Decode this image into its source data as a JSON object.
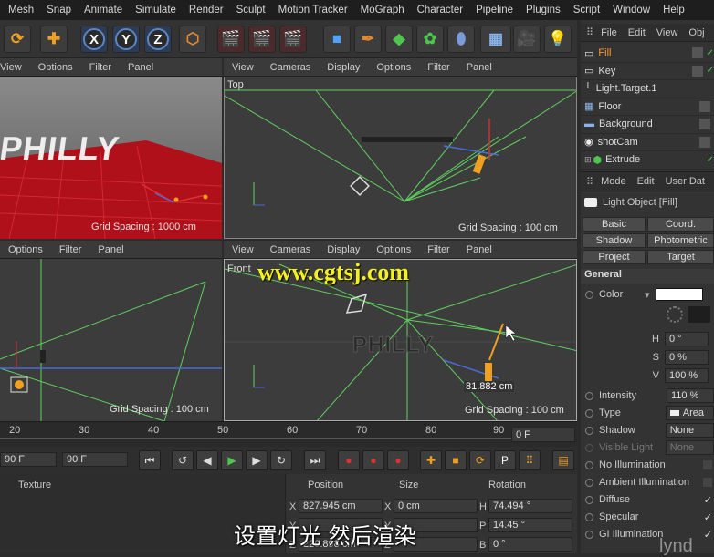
{
  "menu": [
    "Mesh",
    "Snap",
    "Animate",
    "Simulate",
    "Render",
    "Sculpt",
    "Motion Tracker",
    "MoGraph",
    "Character",
    "Pipeline",
    "Plugins",
    "Script",
    "Window",
    "Help"
  ],
  "toolbar": {
    "x": "X",
    "y": "Y",
    "z": "Z"
  },
  "viewport_menu": [
    "View",
    "Cameras",
    "Display",
    "Options",
    "Filter",
    "Panel"
  ],
  "viewport_menu_short": [
    "Options",
    "Filter",
    "Panel"
  ],
  "viewports": {
    "perspective": {
      "grid": "Grid Spacing : 1000 cm",
      "logo": "PHILLY"
    },
    "top": {
      "name": "Top",
      "grid": "Grid Spacing : 100 cm"
    },
    "right": {
      "grid": "Grid Spacing : 100 cm"
    },
    "front": {
      "name": "Front",
      "grid": "Grid Spacing : 100 cm",
      "logo": "PHILLY",
      "measure": "81.882 cm"
    }
  },
  "watermark": "www.cgtsj.com",
  "subtitle": "设置灯光 然后渲染",
  "brand": "lynd",
  "objects": {
    "menu": [
      "File",
      "Edit",
      "View",
      "Obj"
    ],
    "items": [
      {
        "name": "Fill",
        "color": "#ff9a2e",
        "icon": "light-icon"
      },
      {
        "name": "Key",
        "color": "#dddddd",
        "icon": "light-icon"
      },
      {
        "name": "Light.Target.1",
        "color": "#dddddd",
        "icon": "target-icon"
      },
      {
        "name": "Floor",
        "color": "#dddddd",
        "icon": "floor-icon"
      },
      {
        "name": "Background",
        "color": "#dddddd",
        "icon": "background-icon"
      },
      {
        "name": "shotCam",
        "color": "#dddddd",
        "icon": "camera-icon"
      },
      {
        "name": "Extrude",
        "color": "#dddddd",
        "icon": "extrude-icon"
      }
    ]
  },
  "attributes": {
    "menu": [
      "Mode",
      "Edit",
      "User Dat"
    ],
    "title": "Light Object [Fill]",
    "tabs": [
      "Basic",
      "Coord.",
      "Shadow",
      "Photometric",
      "Project",
      "Target"
    ],
    "section": "General",
    "color_label": "Color",
    "h_label": "H",
    "h_value": "0 °",
    "s_label": "S",
    "s_value": "0 %",
    "v_label": "V",
    "v_value": "100 %",
    "intensity_label": "Intensity",
    "intensity_value": "110 %",
    "type_label": "Type",
    "type_value": "Area",
    "shadow_label": "Shadow",
    "shadow_value": "None",
    "visible_light_label": "Visible Light",
    "visible_light_value": "None",
    "checks": [
      "No Illumination",
      "Ambient Illumination",
      "Diffuse",
      "Specular",
      "GI Illumination"
    ]
  },
  "timeline": {
    "ticks": [
      "20",
      "30",
      "40",
      "50",
      "60",
      "70",
      "80",
      "90"
    ],
    "frame": "0 F"
  },
  "transport": {
    "start": "90 F",
    "end": "90 F"
  },
  "coords": {
    "texture_label": "Texture",
    "headers": [
      "Position",
      "Size",
      "Rotation"
    ],
    "rows": [
      {
        "axis": "X",
        "pos": "827.945 cm",
        "saxis": "X",
        "size": "0 cm",
        "raxis": "H",
        "rot": "74.494 °"
      },
      {
        "axis": "Y",
        "pos": "",
        "saxis": "Y",
        "size": "",
        "raxis": "P",
        "rot": "14.45 °"
      },
      {
        "axis": "Z",
        "pos": "229.898 cm",
        "saxis": "Z",
        "size": "",
        "raxis": "B",
        "rot": "0 °"
      }
    ]
  }
}
